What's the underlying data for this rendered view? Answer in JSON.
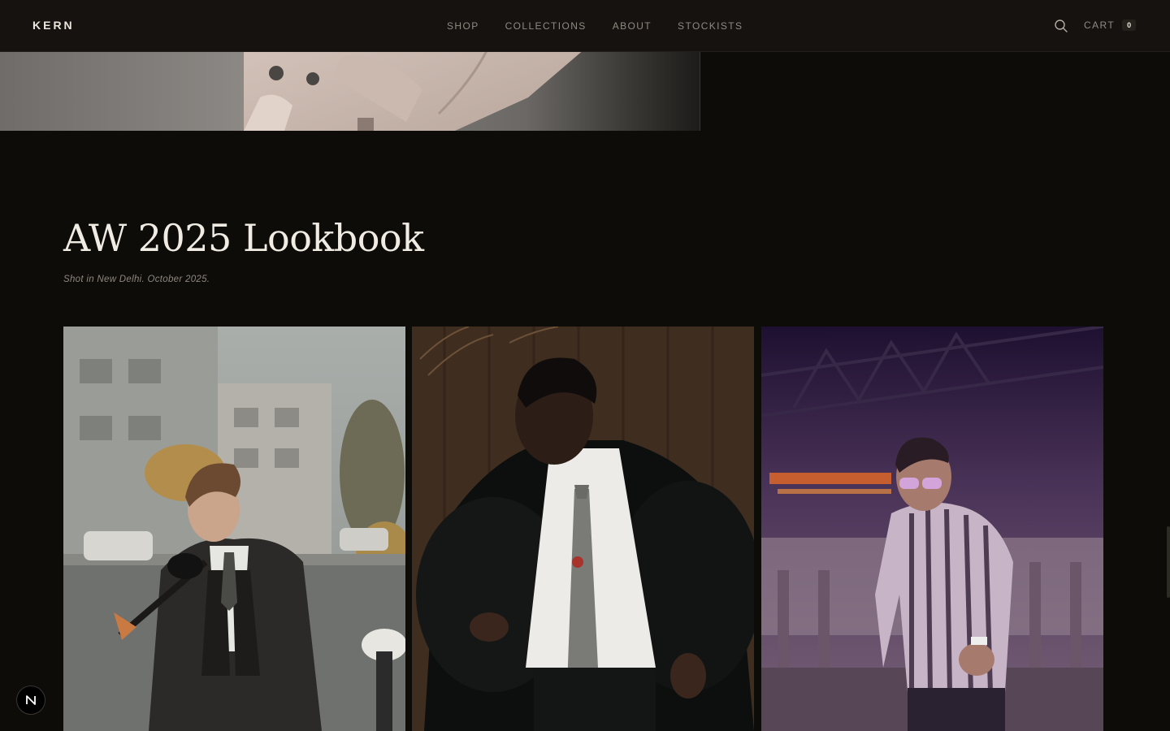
{
  "header": {
    "logo": "KERN",
    "nav": [
      "SHOP",
      "COLLECTIONS",
      "ABOUT",
      "STOCKISTS"
    ],
    "search_icon": "search-icon",
    "cart_label": "CART",
    "cart_count": "0"
  },
  "lookbook": {
    "title": "AW 2025 Lookbook",
    "caption": "Shot in New Delhi. October 2025."
  },
  "floating_badge": {
    "icon": "next-n-icon"
  },
  "colors": {
    "background": "#0e0c09",
    "header_bg": "#15120f",
    "text_primary": "#f1ece3",
    "text_muted": "#8f8a82"
  }
}
